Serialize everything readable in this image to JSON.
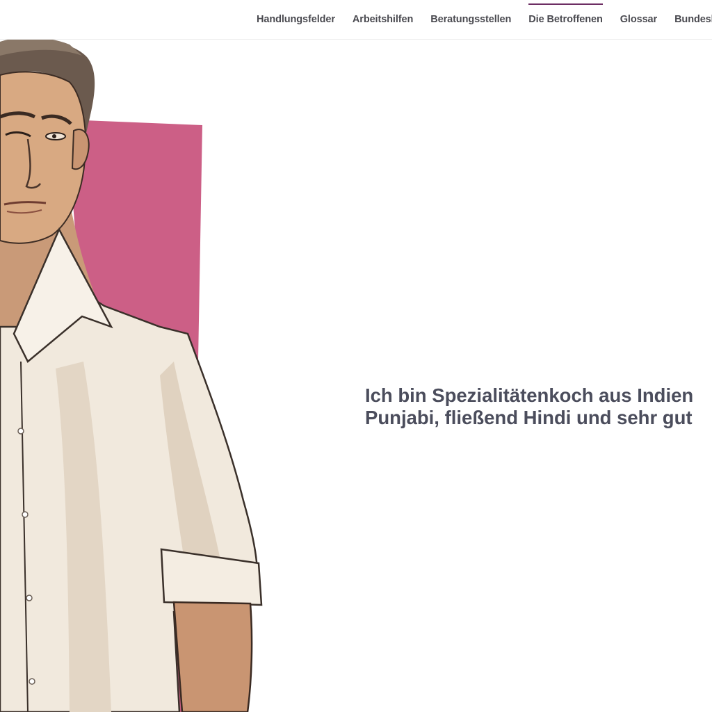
{
  "nav": {
    "items": [
      {
        "label": "Handlungsfelder",
        "active": false
      },
      {
        "label": "Arbeitshilfen",
        "active": false
      },
      {
        "label": "Beratungsstellen",
        "active": false
      },
      {
        "label": "Die Betroffenen",
        "active": true
      },
      {
        "label": "Glossar",
        "active": false
      },
      {
        "label": "Bundesland",
        "active": false
      }
    ],
    "active_color": "#6d2e63"
  },
  "hero": {
    "image": "illustrated-man-portrait",
    "accent_color": "#cc5f86"
  },
  "quote": {
    "line1": "Ich bin Spezialitätenkoch aus Indien",
    "line2": "Punjabi, fließend Hindi und sehr gut"
  }
}
